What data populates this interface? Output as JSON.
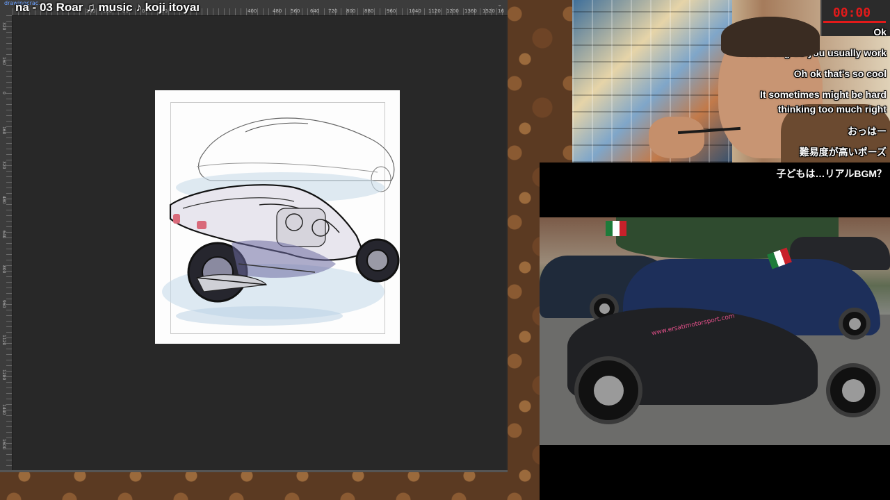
{
  "stream_overlay": {
    "now_playing": "na - 03 Roar          ♫ music ♪ koji itoyaı"
  },
  "editor": {
    "document_tab": "drawingcrac...",
    "ruler_top_labels": [
      "320",
      "240",
      "160",
      "80",
      "0",
      "80",
      "160",
      "240",
      "320",
      "400",
      "480",
      "560",
      "640",
      "720",
      "800",
      "880",
      "960",
      "1040",
      "1120",
      "1200",
      "1280",
      "1360",
      "1440",
      "1520",
      "16"
    ],
    "ruler_left_labels": [
      "320",
      "240",
      "160",
      "80",
      "0",
      "80",
      "160",
      "240",
      "320",
      "400",
      "480",
      "560",
      "640",
      "720",
      "800",
      "880",
      "960",
      "1040",
      "1120",
      "1200",
      "1280",
      "1360",
      "1440",
      "1520",
      "1600",
      "1680"
    ]
  },
  "webcam": {
    "timer": "00:00"
  },
  "chat": {
    "comments": [
      "Ok",
      "How long do you usually work",
      "Oh ok that's so cool",
      "It sometimes might be hard",
      "thinking too much right",
      "おっはー",
      "難易度が高いポーズ",
      "子どもは…リアルBGM？"
    ]
  },
  "reference": {
    "photo_text": "www.ersatimotorsport.com"
  },
  "colors": {
    "editor_bg": "#2a2a2a",
    "ruler_bg": "#3c3c3c",
    "timer_red": "#e21a1a",
    "trike_black": "#202124",
    "sedan_blue": "#1d2f5a"
  }
}
